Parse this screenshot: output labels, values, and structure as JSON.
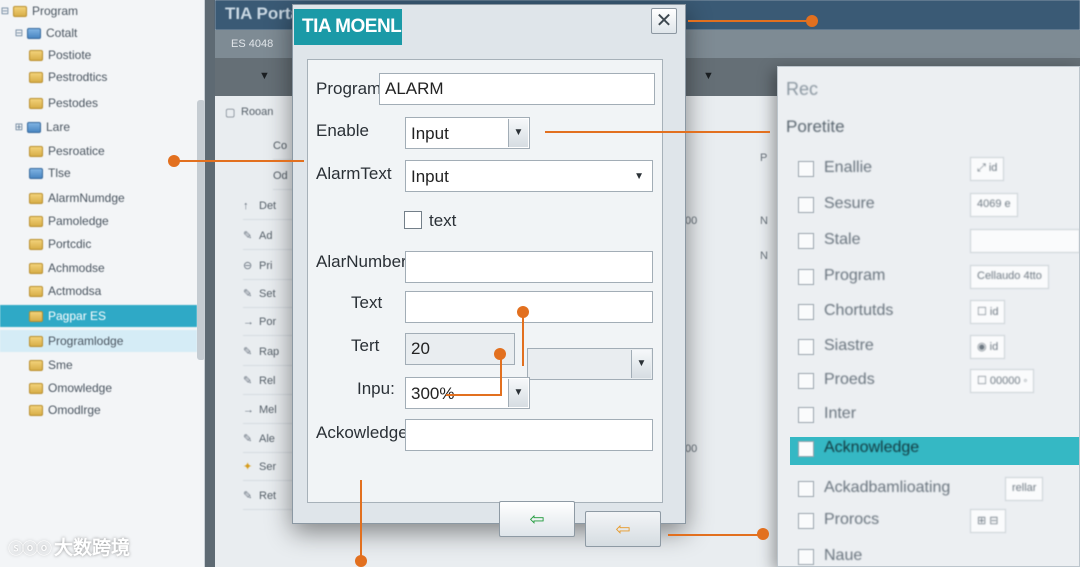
{
  "tree": {
    "items": [
      {
        "label": "Program",
        "exp": "⊟",
        "icon": "folder"
      },
      {
        "label": "Cotalt",
        "exp": "⊟",
        "icon": "folder-blue"
      },
      {
        "label": "Postiote",
        "exp": "",
        "icon": "folder"
      },
      {
        "label": "Pestrodtics",
        "exp": "",
        "icon": "folder"
      },
      {
        "label": "Pestodes",
        "exp": "",
        "icon": "folder"
      },
      {
        "label": "Lare",
        "exp": "⊞",
        "icon": "folder-blue"
      },
      {
        "label": "Pesroatice",
        "exp": "",
        "icon": "folder"
      },
      {
        "label": "Tlse",
        "exp": "",
        "icon": "folder-blue"
      },
      {
        "label": "AlarmNumdge",
        "exp": "",
        "icon": "folder"
      },
      {
        "label": "Pamoledge",
        "exp": "",
        "icon": "folder"
      },
      {
        "label": "Portcdic",
        "exp": "",
        "icon": "folder"
      },
      {
        "label": "Achmodse",
        "exp": "",
        "icon": "folder"
      },
      {
        "label": "Actmodsa",
        "exp": "",
        "icon": "folder"
      },
      {
        "label": "Pagpar ES",
        "exp": "",
        "icon": "folder"
      },
      {
        "label": "Programlodge",
        "exp": "",
        "icon": "folder"
      },
      {
        "label": "Sme",
        "exp": "",
        "icon": "folder"
      },
      {
        "label": "Omowledge",
        "exp": "",
        "icon": "folder"
      },
      {
        "label": "Omodlrge",
        "exp": "",
        "icon": "folder"
      }
    ]
  },
  "portal": {
    "title": "TIA Portal",
    "subtitle": "ES 4048",
    "grid_header": "Rooan",
    "grid_col_a": "Co",
    "grid_col_b": "Od",
    "rows": [
      "Det",
      "Ad",
      "Pri",
      "Set",
      "Por",
      "Rap",
      "Rel",
      "Mel",
      "Ale",
      "Ser",
      "Ret"
    ],
    "extra_value": "00",
    "extra_n1": "N",
    "extra_n2": "N",
    "extra_p": "P"
  },
  "dialog": {
    "title": "TIA MOENL",
    "close_glyph": "✕",
    "program_label": "Program_",
    "program_value": "ALARM",
    "enable_label": "Enable",
    "enable_value": "Input",
    "alarmtext_label": "AlarmText",
    "alarmtext_value": "Input",
    "checkbox_label": "text",
    "alarnumber_label": "AlarNumber",
    "alarnumber_value": "",
    "text_label": "Text",
    "text_value": "",
    "tert_label": "Tert",
    "tert_value": "20",
    "tert_combo_value": "",
    "inpu_label": "Inpu:",
    "inpu_value": "300%",
    "ackowledge_label": "Ackowledge",
    "ackowledge_value": "",
    "back_glyph": "⇦",
    "next_glyph": "⇦"
  },
  "props": {
    "title": "Rec",
    "header": "Poretite",
    "rows": [
      {
        "label": "Enallie",
        "value": "⤢ id"
      },
      {
        "label": "Sesure",
        "value": "4069 e"
      },
      {
        "label": "Stale",
        "value": ""
      },
      {
        "label": "Program",
        "value": "Cellaudo 4tto"
      },
      {
        "label": "Chortutds",
        "value": "☐ id"
      },
      {
        "label": "Siastre",
        "value": "◉ id"
      },
      {
        "label": "Proeds",
        "value": "☐ 00000 ◦"
      },
      {
        "label": "Inter",
        "value": ""
      },
      {
        "label": "Acknowledge",
        "value": ""
      },
      {
        "label": "Ackadbamlioating",
        "value": "rellar"
      },
      {
        "label": "Prorocs",
        "value": "⊞ ⊟"
      },
      {
        "label": "Naue",
        "value": ""
      }
    ]
  },
  "watermark": {
    "logo": "ⓢⓞⓞ",
    "text": "大数跨境"
  },
  "colors": {
    "accent": "#1b9aa7",
    "callout": "#e2701f",
    "selection": "#2fa9c6"
  }
}
